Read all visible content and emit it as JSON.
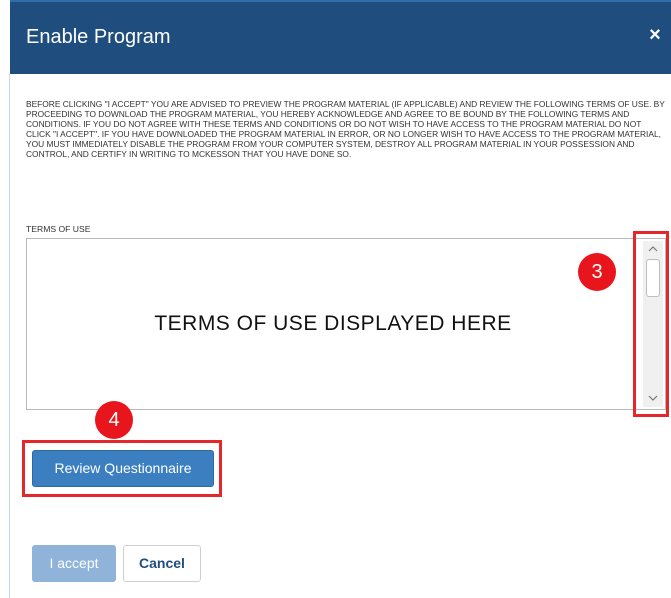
{
  "dialog": {
    "title": "Enable Program",
    "close_symbol": "×"
  },
  "disclaimer": "BEFORE CLICKING \"I ACCEPT\" YOU ARE ADVISED TO PREVIEW THE PROGRAM MATERIAL (IF APPLICABLE) AND REVIEW THE FOLLOWING TERMS OF USE. BY PROCEEDING TO DOWNLOAD THE PROGRAM MATERIAL, YOU HEREBY ACKNOWLEDGE AND AGREE TO BE BOUND BY THE FOLLOWING TERMS AND CONDITIONS. IF YOU DO NOT AGREE WITH THESE TERMS AND CONDITIONS OR DO NOT WISH TO HAVE ACCESS TO THE PROGRAM MATERIAL DO NOT CLICK \"I ACCEPT\". IF YOU HAVE DOWNLOADED THE PROGRAM MATERIAL IN ERROR, OR NO LONGER WISH TO HAVE ACCESS TO THE PROGRAM MATERIAL, YOU MUST IMMEDIATELY DISABLE THE PROGRAM FROM YOUR COMPUTER SYSTEM, DESTROY ALL PROGRAM MATERIAL IN YOUR POSSESSION AND CONTROL, AND CERTIFY IN WRITING TO MCKESSON THAT YOU HAVE DONE SO.",
  "terms": {
    "label": "TERMS OF USE",
    "content": "TERMS OF USE DISPLAYED HERE"
  },
  "annotations": {
    "badge_3": "3",
    "badge_4": "4",
    "highlight_color": "#e5262b",
    "badge_color": "#e8151c"
  },
  "buttons": {
    "review": "Review Questionnaire",
    "accept": "I accept",
    "cancel": "Cancel"
  },
  "colors": {
    "header": "#1f4e7e",
    "primary_button": "#3b7fc1",
    "disabled_button": "#8fb3d9"
  },
  "icons": {
    "scroll_up": "chevron-up-icon",
    "scroll_down": "chevron-down-icon",
    "close": "close-icon"
  }
}
